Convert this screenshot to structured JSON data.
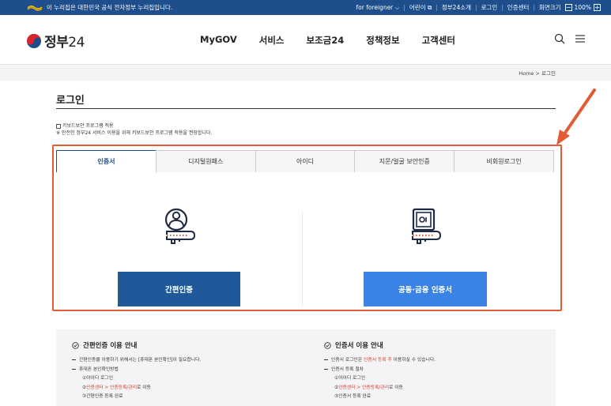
{
  "topbar": {
    "notice": "이 누리집은 대한민국 공식 전자정부 누리집입니다.",
    "links": [
      "for foreigner",
      "어린이",
      "정부24소개",
      "로그인",
      "인증센터",
      "화면크기"
    ],
    "zoom": "100%",
    "minus": "−",
    "plus": "+"
  },
  "header": {
    "logo_text": "정부",
    "logo_num": "24",
    "nav": [
      "MyGOV",
      "서비스",
      "보조금24",
      "정책정보",
      "고객센터"
    ]
  },
  "breadcrumb": {
    "home": "Home",
    "sep": ">",
    "current": "로그인"
  },
  "page": {
    "title": "로그인",
    "keyboard_security": "키보드보안 프로그램 적용",
    "keyboard_note": "※ 안전한 정부24 서비스 이용을 위해 키보드보안 프로그램 적용을 권장합니다."
  },
  "tabs": [
    "인증서",
    "디지털원패스",
    "아이디",
    "지문/얼굴 보안인증",
    "비회원로그인"
  ],
  "active_tab": 0,
  "buttons": {
    "simple": "간편인증",
    "cert": "공동·금융 인증서"
  },
  "info": {
    "left": {
      "title": "간편인증 이용 안내",
      "lines": [
        {
          "type": "dash",
          "text": "간편인증을 이용하기 위해서는 [휴대폰 본인확인]이 필요합니다."
        },
        {
          "type": "dash",
          "text": "휴대폰 본인확인방법"
        },
        {
          "type": "sub",
          "text": "①아이디 로그인"
        },
        {
          "type": "sub",
          "pre": "②",
          "em": "인증센터 > 인증등록/관리",
          "post": "로 이동"
        },
        {
          "type": "sub",
          "text": "③간편인증 등록 완료"
        }
      ]
    },
    "right": {
      "title": "인증서 이용 안내",
      "lines": [
        {
          "type": "dash",
          "pre": "인증서 로그인은 ",
          "em": "인증서 등록 후",
          "post": " 이용하실 수 있습니다."
        },
        {
          "type": "dash",
          "text": "인증서 등록 절차"
        },
        {
          "type": "sub",
          "text": "①아이디 로그인"
        },
        {
          "type": "sub",
          "pre": "②",
          "em": "인증센터 > 인증등록/관리",
          "post": "로 이동"
        },
        {
          "type": "sub",
          "text": "③인증서 등록 완료"
        }
      ]
    }
  },
  "colors": {
    "primary": "#1f4e8c",
    "button_simple": "#20599a",
    "button_cert": "#3a83e4",
    "highlight": "#e25b35",
    "emphasis": "#d93a2c"
  }
}
